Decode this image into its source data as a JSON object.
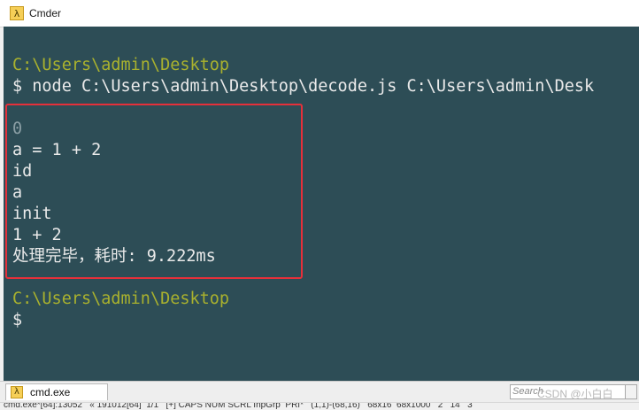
{
  "window": {
    "title": "Cmder",
    "app_icon_glyph": "λ"
  },
  "terminal": {
    "colors": {
      "background": "#2d4d56",
      "text": "#eaeaea",
      "path": "#a9b12e",
      "highlight_border": "#e5303a"
    },
    "lines": [
      {
        "kind": "path",
        "text": "C:\\Users\\admin\\Desktop"
      },
      {
        "kind": "command",
        "text": "$ node C:\\Users\\admin\\Desktop\\decode.js C:\\Users\\admin\\Desk"
      },
      {
        "kind": "output",
        "text": "0"
      },
      {
        "kind": "output",
        "text": "a = 1 + 2"
      },
      {
        "kind": "output",
        "text": "id"
      },
      {
        "kind": "output",
        "text": "a"
      },
      {
        "kind": "output",
        "text": "init"
      },
      {
        "kind": "output",
        "text": "1 + 2"
      },
      {
        "kind": "output",
        "text": "处理完毕，耗时: 9.222ms"
      },
      {
        "kind": "path",
        "text": "C:\\Users\\admin\\Desktop"
      },
      {
        "kind": "prompt",
        "text": "$"
      }
    ]
  },
  "tabs": [
    {
      "label": "cmd.exe",
      "icon": "lambda-icon"
    }
  ],
  "search": {
    "placeholder": "Search"
  },
  "watermark": "CSDN @小白白",
  "status": "cmd.exe*[64]:13052   « 191012[64]  1/1   [+] CAPS NUM SCRL InpGrp  PRI*   (1,1)-(68,16)   68x16  68x1000   2   14   3"
}
